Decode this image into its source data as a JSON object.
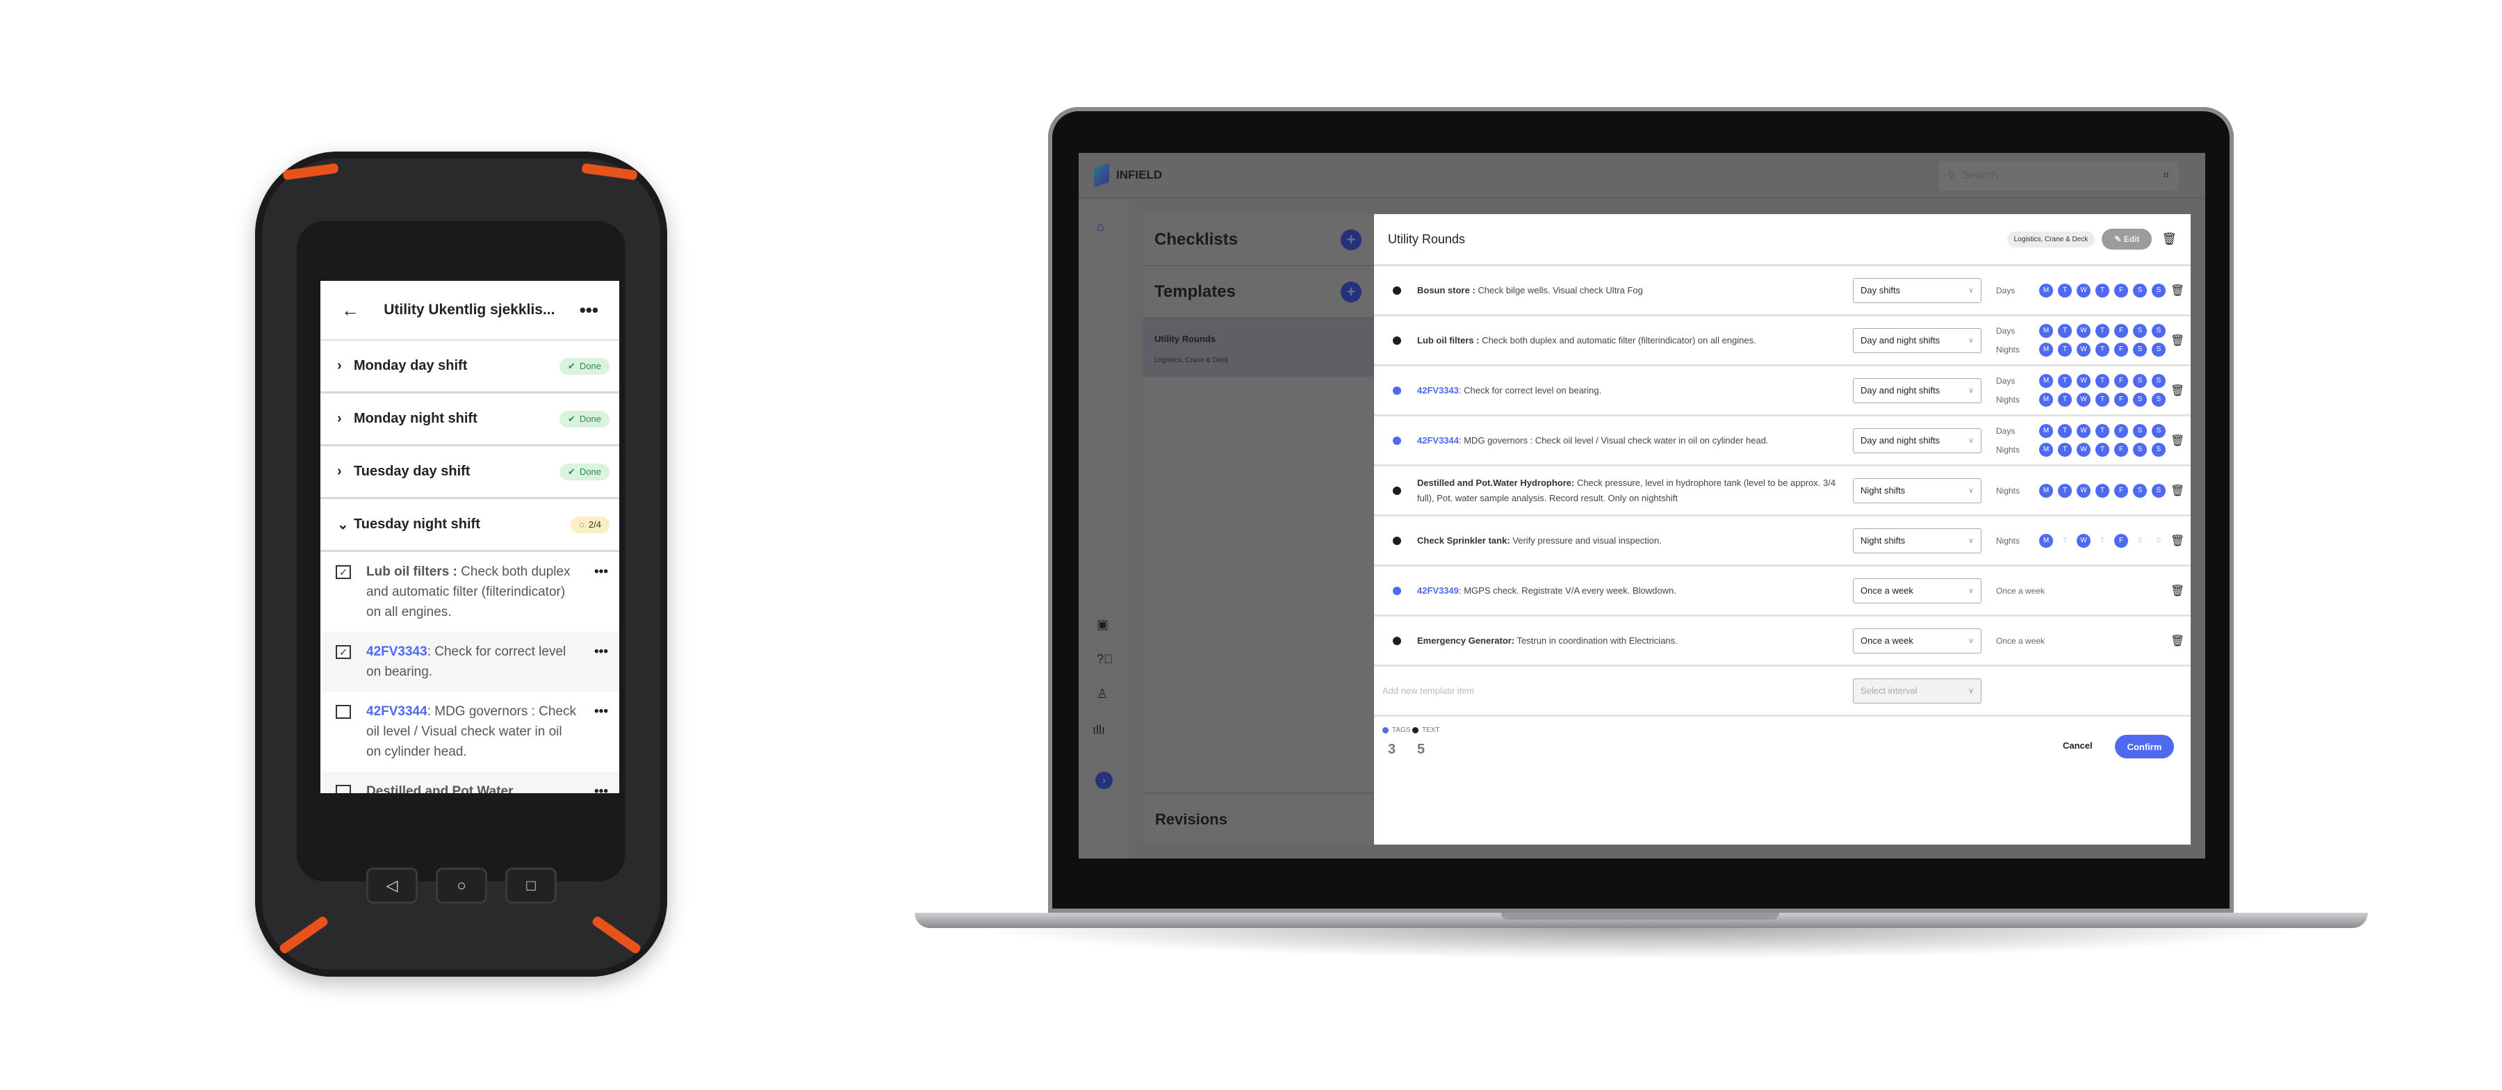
{
  "colors": {
    "accent": "#4d6af0",
    "text_bullet": "#1e1e1e",
    "done_bg": "#d9f3df",
    "progress_bg": "#fbedc4",
    "device_orange": "#e8531c"
  },
  "phone": {
    "title": "Utility Ukentlig sjekklis...",
    "back_icon": "arrow-left-icon",
    "more_icon": "more-horizontal-icon",
    "sections": [
      {
        "name": "Monday day shift",
        "status": "Done",
        "state": "done"
      },
      {
        "name": "Monday night shift",
        "status": "Done",
        "state": "done"
      },
      {
        "name": "Tuesday day shift",
        "status": "Done",
        "state": "done"
      },
      {
        "name": "Tuesday night shift",
        "status": "2/4",
        "state": "progress"
      }
    ],
    "items": [
      {
        "tag": "",
        "title": "Lub oil filters :",
        "text": " Check both duplex and automatic filter (filterindicator) on all engines.",
        "checked": true
      },
      {
        "tag": "42FV3343",
        "title": "",
        "text": ": Check for correct level on bearing.",
        "checked": true
      },
      {
        "tag": "42FV3344",
        "title": "",
        "text": ": MDG governors : Check oil level / Visual check water in oil on cylinder head.",
        "checked": false
      },
      {
        "tag": "",
        "title": "Destilled and Pot.Water",
        "text": "",
        "checked": false
      }
    ],
    "nav_buttons": [
      "◁",
      "○",
      "□"
    ]
  },
  "laptop": {
    "brand": "INFIELD",
    "search_placeholder": "Search",
    "panel": {
      "checklists": "Checklists",
      "templates": "Templates",
      "selected_title": "Utility Rounds",
      "selected_sub": "Logistics, Crane & Deck",
      "revisions": "Revisions"
    },
    "main": {
      "title": "Utility Rounds",
      "chip": "Logistics, Crane & Deck",
      "edit": "Edit",
      "rows": [
        {
          "kind": "text",
          "title": "Bosun store :",
          "text": " Check bilge wells. Visual check Ultra Fog",
          "interval": "Day shifts",
          "schedule": [
            {
              "label": "Days",
              "days": [
                1,
                1,
                1,
                1,
                1,
                1,
                1
              ]
            }
          ]
        },
        {
          "kind": "text",
          "title": "Lub oil filters :",
          "text": " Check both duplex and automatic filter (filterindicator) on all engines.",
          "interval": "Day and night shifts",
          "schedule": [
            {
              "label": "Days",
              "days": [
                1,
                1,
                1,
                1,
                1,
                1,
                1
              ]
            },
            {
              "label": "Nights",
              "days": [
                1,
                1,
                1,
                1,
                1,
                1,
                1
              ]
            }
          ]
        },
        {
          "kind": "tag",
          "title": "42FV3343",
          "text": ": Check for correct level on bearing.",
          "interval": "Day and night shifts",
          "schedule": [
            {
              "label": "Days",
              "days": [
                1,
                1,
                1,
                1,
                1,
                1,
                1
              ]
            },
            {
              "label": "Nights",
              "days": [
                1,
                1,
                1,
                1,
                1,
                1,
                1
              ]
            }
          ]
        },
        {
          "kind": "tag",
          "title": "42FV3344",
          "text": ": MDG governors : Check oil level / Visual check water in oil on cylinder head.",
          "interval": "Day and night shifts",
          "schedule": [
            {
              "label": "Days",
              "days": [
                1,
                1,
                1,
                1,
                1,
                1,
                1
              ]
            },
            {
              "label": "Nights",
              "days": [
                1,
                1,
                1,
                1,
                1,
                1,
                1
              ]
            }
          ]
        },
        {
          "kind": "text",
          "title": "Destilled and Pot.Water Hydrophore:",
          "text": " Check pressure, level in hydrophore tank (level to be approx. 3/4 full), Pot. water sample analysis. Record result. Only on nightshift",
          "interval": "Night shifts",
          "schedule": [
            {
              "label": "Nights",
              "days": [
                1,
                1,
                1,
                1,
                1,
                1,
                1
              ]
            }
          ]
        },
        {
          "kind": "text",
          "title": "Check Sprinkler tank:",
          "text": " Verify pressure and visual inspection.",
          "interval": "Night shifts",
          "schedule": [
            {
              "label": "Nights",
              "days": [
                1,
                0,
                1,
                0,
                1,
                0,
                0
              ]
            }
          ]
        },
        {
          "kind": "tag",
          "title": "42FV3349",
          "text": ": MGPS check. Registrate V/A every week. Blowdown.",
          "interval": "Once a week",
          "once": "Once a week"
        },
        {
          "kind": "text",
          "title": "Emergency Generator:",
          "text": " Testrun in coordination with Electricians.",
          "interval": "Once a week",
          "once": "Once a week"
        }
      ],
      "weekdays": [
        "M",
        "T",
        "W",
        "T",
        "F",
        "S",
        "S"
      ],
      "new_item_placeholder": "Add new template item",
      "interval_placeholder": "Select interval",
      "legend": {
        "tags_label": "TAGS",
        "tags_count": "3",
        "text_label": "TEXT",
        "text_count": "5"
      },
      "cancel": "Cancel",
      "confirm": "Confirm"
    }
  }
}
